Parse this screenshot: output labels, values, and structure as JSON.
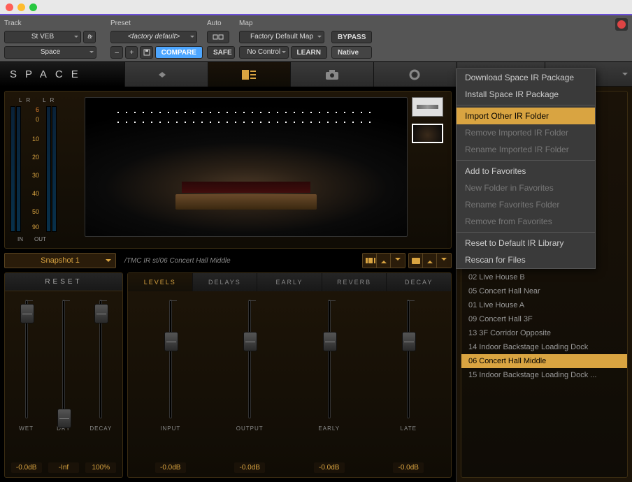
{
  "header": {
    "track_label": "Track",
    "track_value": "St VEB",
    "track_slot": "a",
    "plugin_value": "Space",
    "preset_label": "Preset",
    "preset_value": "<factory default>",
    "compare": "COMPARE",
    "auto_label": "Auto",
    "safe": "SAFE",
    "map_label": "Map",
    "map_value": "Factory Default Map",
    "no_control": "No Control",
    "learn": "LEARN",
    "bypass": "BYPASS",
    "native": "Native"
  },
  "brand": "SPACE",
  "meters": {
    "lr": "L R",
    "in": "IN",
    "out": "OUT",
    "ticks": [
      "6",
      "0",
      "10",
      "20",
      "30",
      "40",
      "50",
      "90"
    ]
  },
  "snapshot": {
    "name": "Snapshot 1",
    "path": "/TMC IR st/06 Concert Hall Middle"
  },
  "reset": "RESET",
  "paramTabs": [
    "LEVELS",
    "DELAYS",
    "EARLY",
    "REVERB",
    "DECAY"
  ],
  "leftSliders": [
    {
      "label": "WET",
      "value": "-0.0dB",
      "pos": 5
    },
    {
      "label": "DRY",
      "value": "-Inf",
      "pos": 155
    },
    {
      "label": "DECAY",
      "value": "100%",
      "pos": 5
    }
  ],
  "rightSliders": [
    {
      "label": "INPUT",
      "value": "-0.0dB",
      "pos": 45
    },
    {
      "label": "OUTPUT",
      "value": "-0.0dB",
      "pos": 45
    },
    {
      "label": "EARLY",
      "value": "-0.0dB",
      "pos": 45
    },
    {
      "label": "LATE",
      "value": "-0.0dB",
      "pos": 45
    }
  ],
  "contextMenu": [
    {
      "text": "Download Space IR Package",
      "type": "item"
    },
    {
      "text": "Install Space IR Package",
      "type": "item"
    },
    {
      "type": "sep"
    },
    {
      "text": "Import Other IR Folder",
      "type": "hl"
    },
    {
      "text": "Remove Imported IR Folder",
      "type": "disabled"
    },
    {
      "text": "Rename Imported IR Folder",
      "type": "disabled"
    },
    {
      "type": "sep"
    },
    {
      "text": "Add to Favorites",
      "type": "item"
    },
    {
      "text": "New Folder in Favorites",
      "type": "disabled"
    },
    {
      "text": "Rename Favorites Folder",
      "type": "disabled"
    },
    {
      "text": "Remove from Favorites",
      "type": "disabled"
    },
    {
      "type": "sep"
    },
    {
      "text": "Reset to Default IR Library",
      "type": "item"
    },
    {
      "text": "Rescan for Files",
      "type": "item"
    }
  ],
  "browser": [
    {
      "text": "02 Live House B"
    },
    {
      "text": "05 Concert Hall Near"
    },
    {
      "text": "01 Live House A"
    },
    {
      "text": "09 Concert Hall 3F"
    },
    {
      "text": "13 3F Corridor Opposite"
    },
    {
      "text": "14 Indoor Backstage Loading Dock"
    },
    {
      "text": "06 Concert Hall Middle",
      "sel": true
    },
    {
      "text": "15 Indoor Backstage Loading Dock ..."
    }
  ]
}
